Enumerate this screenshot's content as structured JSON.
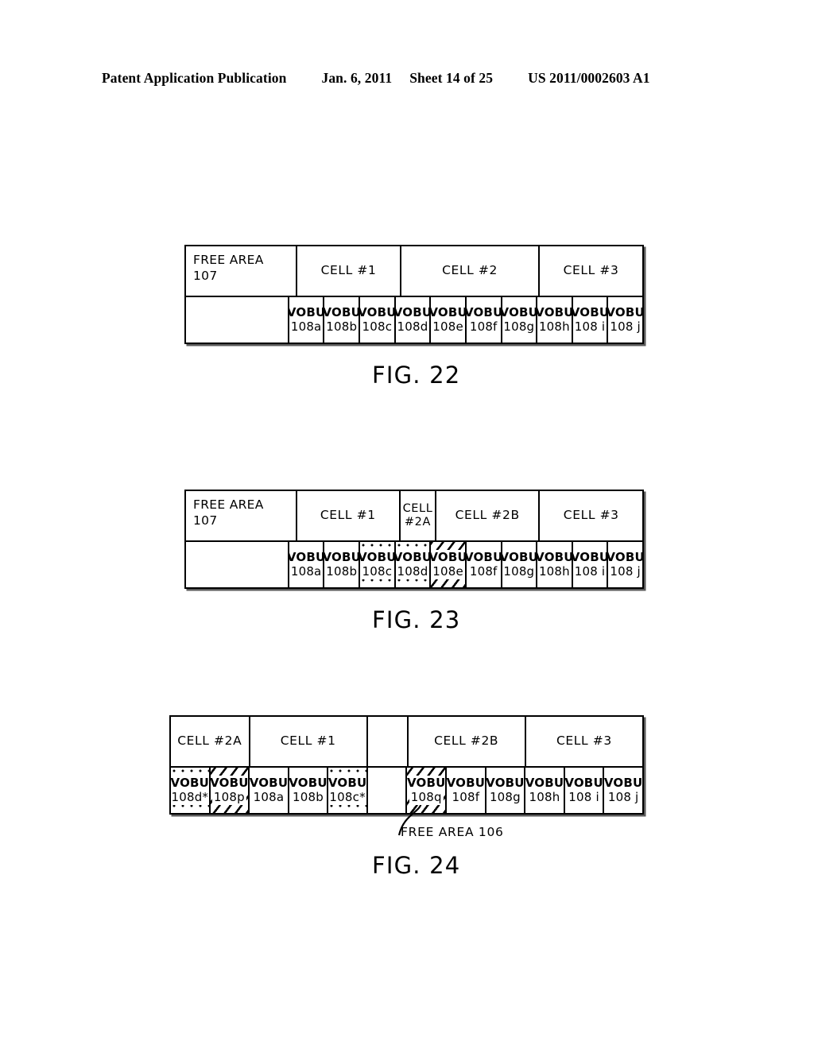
{
  "header": {
    "publication": "Patent Application Publication",
    "date": "Jan. 6, 2011",
    "sheet": "Sheet 14 of 25",
    "number": "US 2011/0002603 A1"
  },
  "figures": [
    {
      "id": "fig22",
      "caption": "FIG. 22",
      "cells": [
        {
          "label": "FREE  AREA\n107",
          "span": 3,
          "kind": "free-area"
        },
        {
          "label": "CELL  #1",
          "span": 3,
          "kind": "cell"
        },
        {
          "label": "CELL  #2",
          "span": 4,
          "kind": "cell"
        },
        {
          "label": "CELL  #3",
          "span": 3,
          "kind": "cell"
        }
      ],
      "vobus": [
        {
          "top": "",
          "bottom": "",
          "fill": "none",
          "blank": true,
          "width": 3
        },
        {
          "top": "VOBU",
          "bottom": "108a",
          "fill": "none"
        },
        {
          "top": "VOBU",
          "bottom": "108b",
          "fill": "none"
        },
        {
          "top": "VOBU",
          "bottom": "108c",
          "fill": "none"
        },
        {
          "top": "VOBU",
          "bottom": "108d",
          "fill": "none"
        },
        {
          "top": "VOBU",
          "bottom": "108e",
          "fill": "none"
        },
        {
          "top": "VOBU",
          "bottom": "108f",
          "fill": "none"
        },
        {
          "top": "VOBU",
          "bottom": "108g",
          "fill": "none"
        },
        {
          "top": "VOBU",
          "bottom": "108h",
          "fill": "none"
        },
        {
          "top": "VOBU",
          "bottom": "108 i",
          "fill": "none"
        },
        {
          "top": "VOBU",
          "bottom": "108 j",
          "fill": "none"
        }
      ]
    },
    {
      "id": "fig23",
      "caption": "FIG. 23",
      "cells": [
        {
          "label": "FREE  AREA\n107",
          "span": 3,
          "kind": "free-area"
        },
        {
          "label": "CELL  #1",
          "span": 3,
          "kind": "cell"
        },
        {
          "label": "CELL\n#2A",
          "span": 1,
          "kind": "cell-two-line"
        },
        {
          "label": "CELL  #2B",
          "span": 3,
          "kind": "cell"
        },
        {
          "label": "CELL  #3",
          "span": 3,
          "kind": "cell"
        }
      ],
      "vobus": [
        {
          "top": "",
          "bottom": "",
          "fill": "none",
          "blank": true,
          "width": 3
        },
        {
          "top": "VOBU",
          "bottom": "108a",
          "fill": "none"
        },
        {
          "top": "VOBU",
          "bottom": "108b",
          "fill": "none"
        },
        {
          "top": "VOBU",
          "bottom": "108c",
          "fill": "dots"
        },
        {
          "top": "VOBU",
          "bottom": "108d",
          "fill": "dots"
        },
        {
          "top": "VOBU",
          "bottom": "108e",
          "fill": "hatch"
        },
        {
          "top": "VOBU",
          "bottom": "108f",
          "fill": "none"
        },
        {
          "top": "VOBU",
          "bottom": "108g",
          "fill": "none"
        },
        {
          "top": "VOBU",
          "bottom": "108h",
          "fill": "none"
        },
        {
          "top": "VOBU",
          "bottom": "108 i",
          "fill": "none"
        },
        {
          "top": "VOBU",
          "bottom": "108 j",
          "fill": "none"
        }
      ]
    },
    {
      "id": "fig24",
      "caption": "FIG. 24",
      "callout": "FREE AREA 106",
      "cells": [
        {
          "label": "CELL  #2A",
          "span": 2,
          "kind": "cell"
        },
        {
          "label": "CELL  #1",
          "span": 3,
          "kind": "cell"
        },
        {
          "label": "",
          "span": 1,
          "kind": "blank"
        },
        {
          "label": "CELL  #2B",
          "span": 3,
          "kind": "cell"
        },
        {
          "label": "CELL  #3",
          "span": 3,
          "kind": "cell"
        }
      ],
      "vobus": [
        {
          "top": "VOBU",
          "bottom": "108d*",
          "fill": "dots"
        },
        {
          "top": "VOBU",
          "bottom": "108p",
          "fill": "hatch"
        },
        {
          "top": "VOBU",
          "bottom": "108a",
          "fill": "none"
        },
        {
          "top": "VOBU",
          "bottom": "108b",
          "fill": "none"
        },
        {
          "top": "VOBU",
          "bottom": "108c*",
          "fill": "dots"
        },
        {
          "top": "",
          "bottom": "",
          "fill": "none",
          "blank": true
        },
        {
          "top": "VOBU",
          "bottom": "108q",
          "fill": "hatch"
        },
        {
          "top": "VOBU",
          "bottom": "108f",
          "fill": "none"
        },
        {
          "top": "VOBU",
          "bottom": "108g",
          "fill": "none"
        },
        {
          "top": "VOBU",
          "bottom": "108h",
          "fill": "none"
        },
        {
          "top": "VOBU",
          "bottom": "108 i",
          "fill": "none"
        },
        {
          "top": "VOBU",
          "bottom": "108 j",
          "fill": "none"
        }
      ]
    }
  ]
}
